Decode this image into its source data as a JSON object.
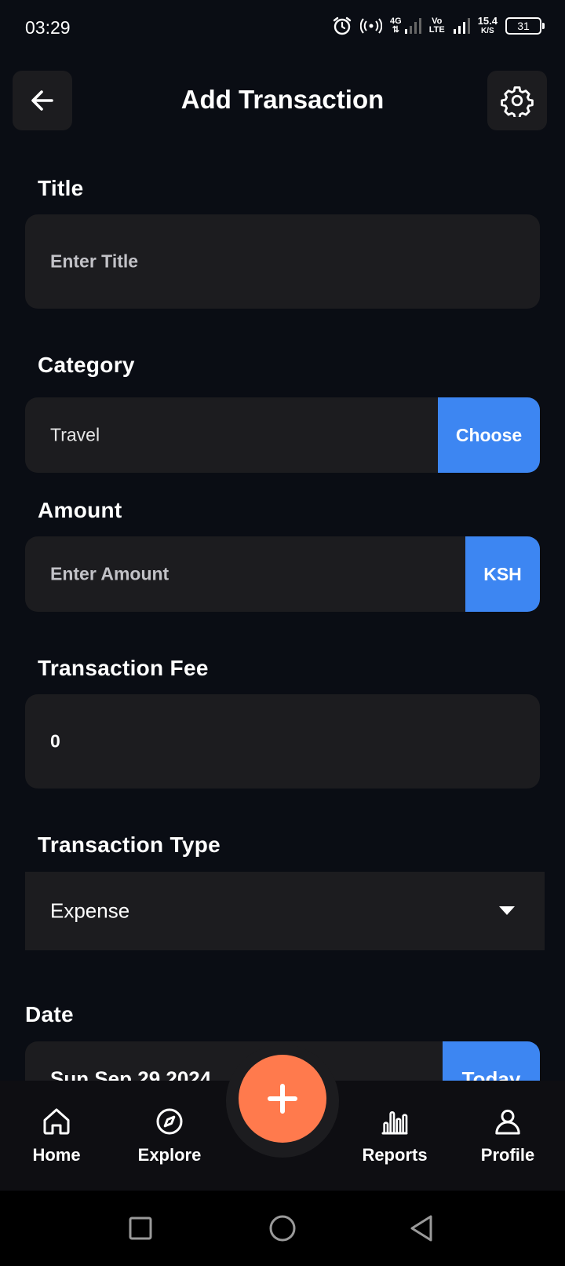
{
  "status_bar": {
    "time": "03:29",
    "net_4g": "4G",
    "volte_top": "Vo",
    "volte_bottom": "LTE",
    "speed_value": "15.4",
    "speed_unit": "K/S",
    "battery": "31"
  },
  "header": {
    "title": "Add Transaction",
    "back_icon": "arrow-left-icon",
    "settings_icon": "gear-icon"
  },
  "form": {
    "title": {
      "label": "Title",
      "placeholder": "Enter Title"
    },
    "category": {
      "label": "Category",
      "value": "Travel",
      "button": "Choose"
    },
    "amount": {
      "label": "Amount",
      "placeholder": "Enter Amount",
      "currency": "KSH"
    },
    "fee": {
      "label": "Transaction Fee",
      "value": "0"
    },
    "type": {
      "label": "Transaction Type",
      "value": "Expense"
    },
    "date": {
      "label": "Date",
      "value": "Sun Sep 29 2024",
      "button": "Today"
    }
  },
  "nav": {
    "items": [
      {
        "label": "Home",
        "icon": "home-icon"
      },
      {
        "label": "Explore",
        "icon": "compass-icon"
      },
      {
        "label": "Reports",
        "icon": "bar-chart-icon"
      },
      {
        "label": "Profile",
        "icon": "user-icon"
      }
    ],
    "fab_icon": "plus-icon"
  },
  "colors": {
    "background": "#0a0d14",
    "field": "#1c1c1f",
    "accent": "#3d86f2",
    "fab": "#ff7a4d"
  }
}
